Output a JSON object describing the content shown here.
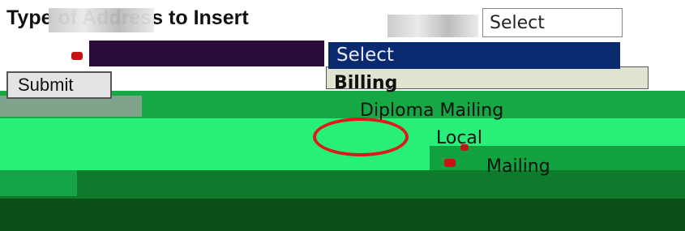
{
  "form": {
    "label": "Type of Address to Insert",
    "select_value": "Select",
    "submit_label": "Submit"
  },
  "dropdown": {
    "options": [
      "Select",
      "Billing",
      "Diploma Mailing",
      "Local",
      "Mailing"
    ]
  },
  "colors": {
    "bright_green": "#26f07a",
    "mid_green": "#15b04a",
    "dark_green": "#0a5c1e",
    "selected_blue": "#0a2a70",
    "annotation_red": "#e01818"
  }
}
